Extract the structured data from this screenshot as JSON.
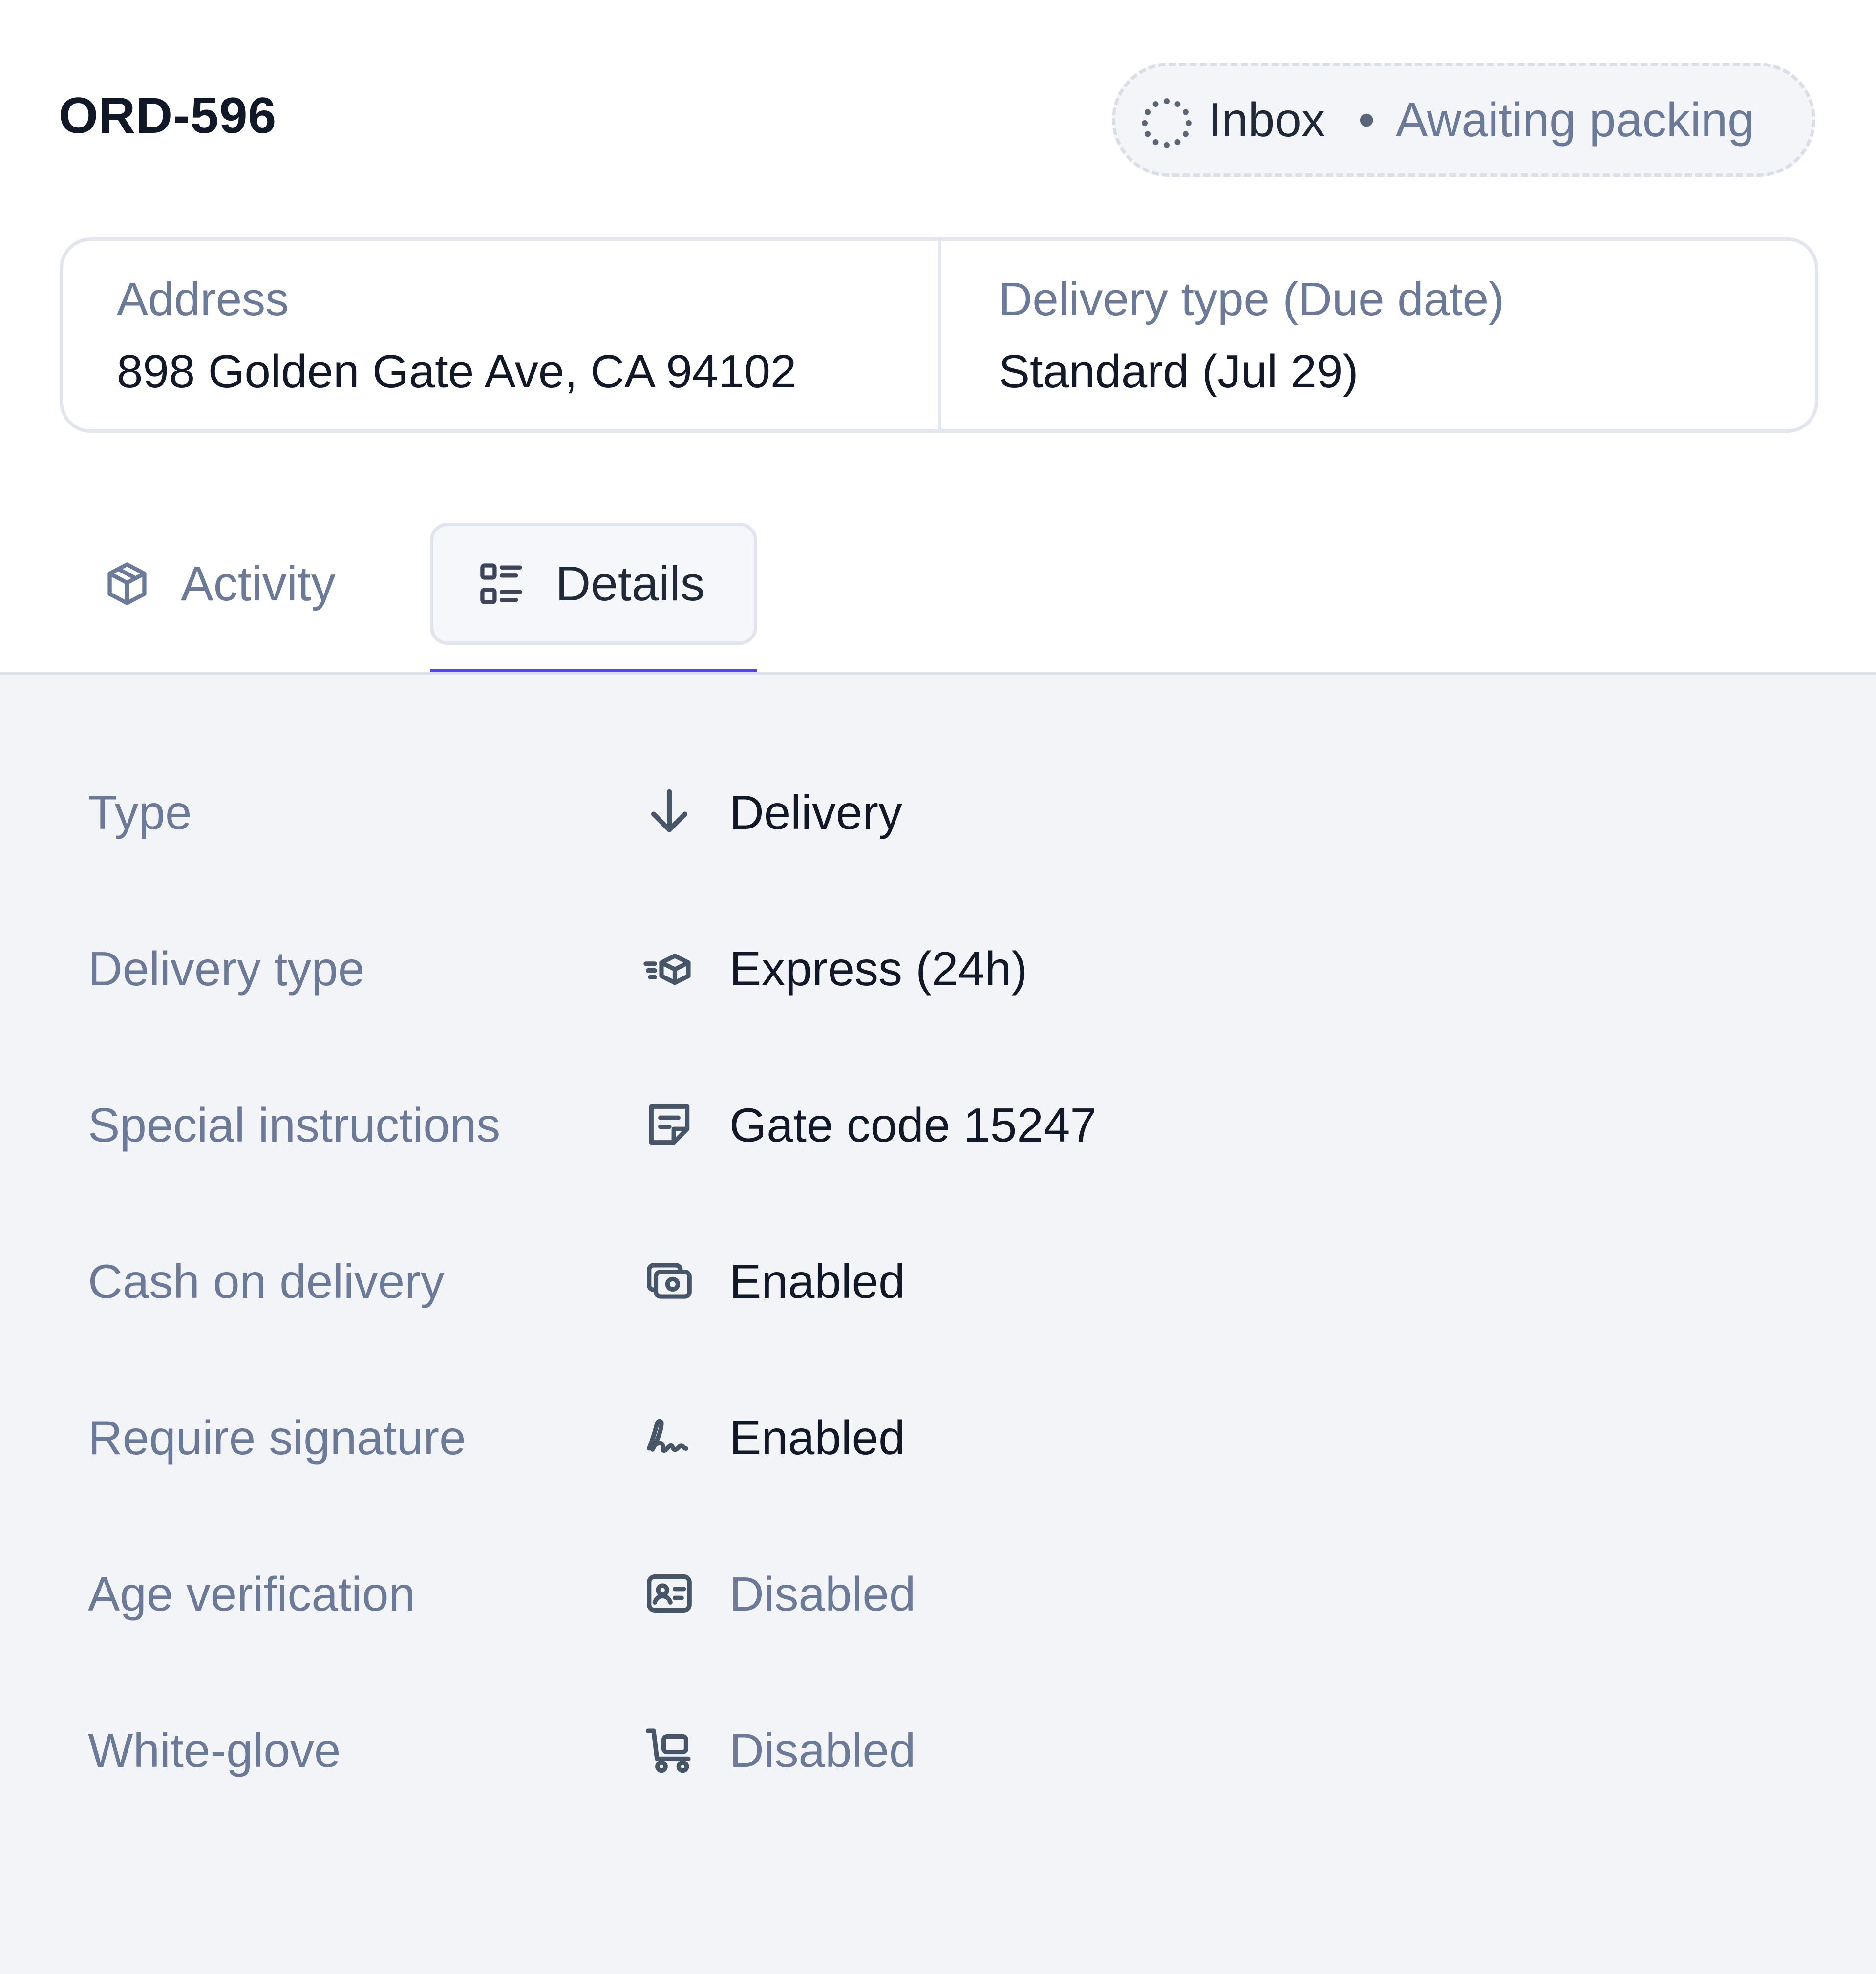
{
  "header": {
    "order_id": "ORD-596",
    "status": {
      "icon": "dotted-circle-icon",
      "label": "Inbox",
      "separator": "•",
      "substatus": "Awaiting packing"
    }
  },
  "info_card": {
    "address": {
      "label": "Address",
      "value": "898 Golden Gate Ave, CA 94102"
    },
    "delivery": {
      "label": "Delivery type (Due date)",
      "value": "Standard (Jul 29)"
    }
  },
  "tabs": [
    {
      "label": "Activity",
      "icon": "package-icon",
      "selected": false
    },
    {
      "label": "Details",
      "icon": "list-details-icon",
      "selected": true
    }
  ],
  "details": [
    {
      "label": "Type",
      "value": "Delivery",
      "icon": "arrow-down-icon",
      "muted": false
    },
    {
      "label": "Delivery type",
      "value": "Express (24h)",
      "icon": "fast-delivery-icon",
      "muted": false
    },
    {
      "label": "Special instructions",
      "value": "Gate code 15247",
      "icon": "note-icon",
      "muted": false
    },
    {
      "label": "Cash on delivery",
      "value": "Enabled",
      "icon": "cash-icon",
      "muted": false
    },
    {
      "label": "Require signature",
      "value": "Enabled",
      "icon": "signature-icon",
      "muted": false
    },
    {
      "label": "Age verification",
      "value": "Disabled",
      "icon": "id-card-icon",
      "muted": true
    },
    {
      "label": "White-glove",
      "value": "Disabled",
      "icon": "hand-truck-icon",
      "muted": true
    }
  ],
  "colors": {
    "accent": "#4f46e5",
    "text_primary": "#111827",
    "text_muted": "#6b7a99",
    "panel_background": "#f3f4f8",
    "border": "#e1e5ee"
  }
}
